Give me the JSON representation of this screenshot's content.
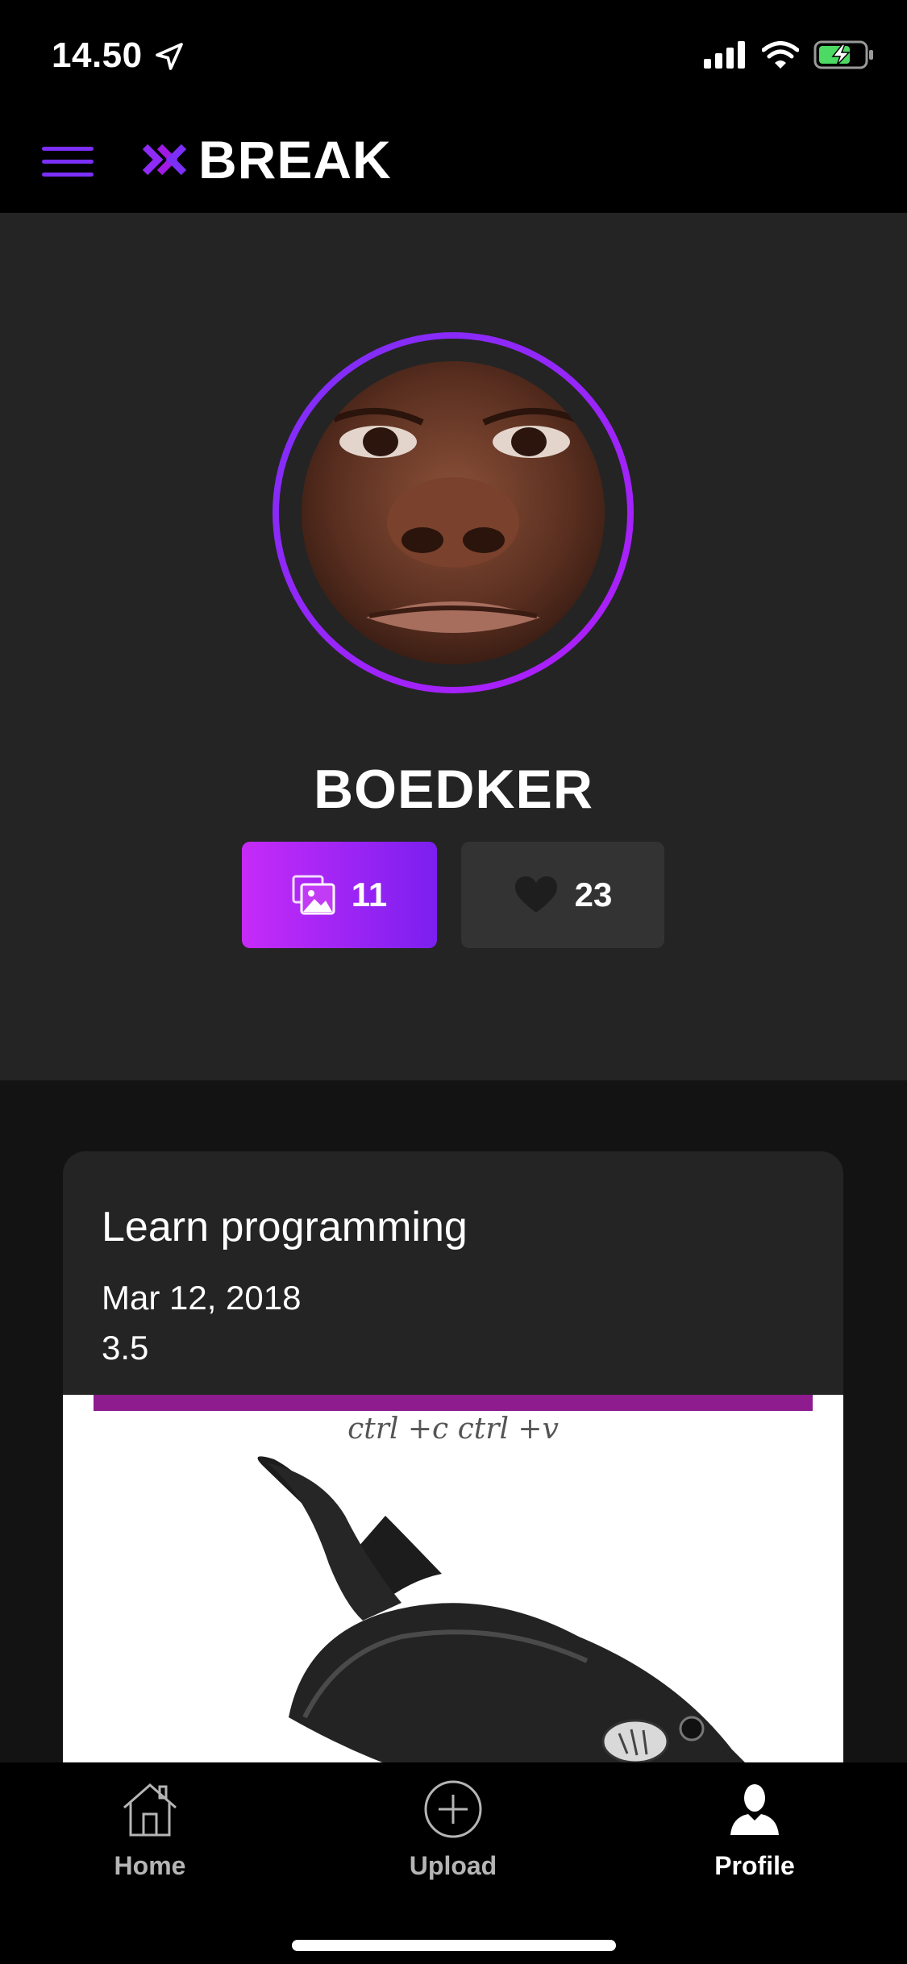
{
  "status_bar": {
    "time": "14.50"
  },
  "header": {
    "logo_text": "BREAK",
    "accent_color": "#7b2ff7"
  },
  "profile": {
    "username": "BOEDKER",
    "photos_count": "11",
    "likes_count": "23"
  },
  "posts": [
    {
      "title": "Learn programming",
      "date": "Mar 12, 2018",
      "score": "3.5",
      "image_caption": "ctrl +c ctrl +v"
    }
  ],
  "tabs": [
    {
      "label": "Home",
      "icon": "home-icon"
    },
    {
      "label": "Upload",
      "icon": "plus-circle-icon"
    },
    {
      "label": "Profile",
      "icon": "user-icon"
    }
  ],
  "active_tab": "Profile"
}
